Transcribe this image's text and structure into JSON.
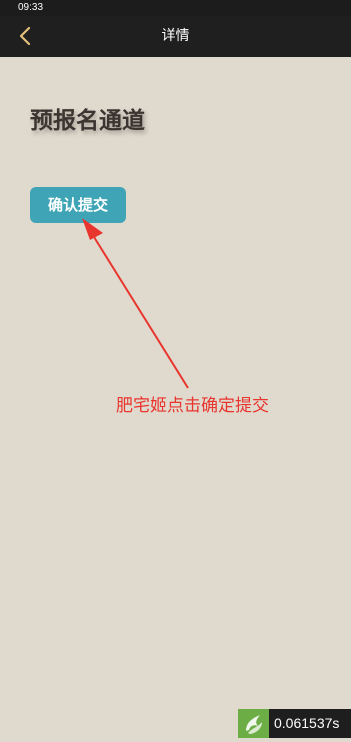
{
  "status_bar": {
    "time": "09:33"
  },
  "nav": {
    "back_icon": "chevron-left-icon",
    "title": "详情",
    "back_icon_color": "#e3c07c"
  },
  "page": {
    "title": "预报名通道",
    "confirm_button_label": "确认提交",
    "button_color": "#3fa4b5"
  },
  "annotation": {
    "text": "肥宅姬点击确定提交",
    "color": "#e8352e"
  },
  "timer": {
    "logo_icon": "app-logo-icon",
    "value": "0.061537s"
  }
}
